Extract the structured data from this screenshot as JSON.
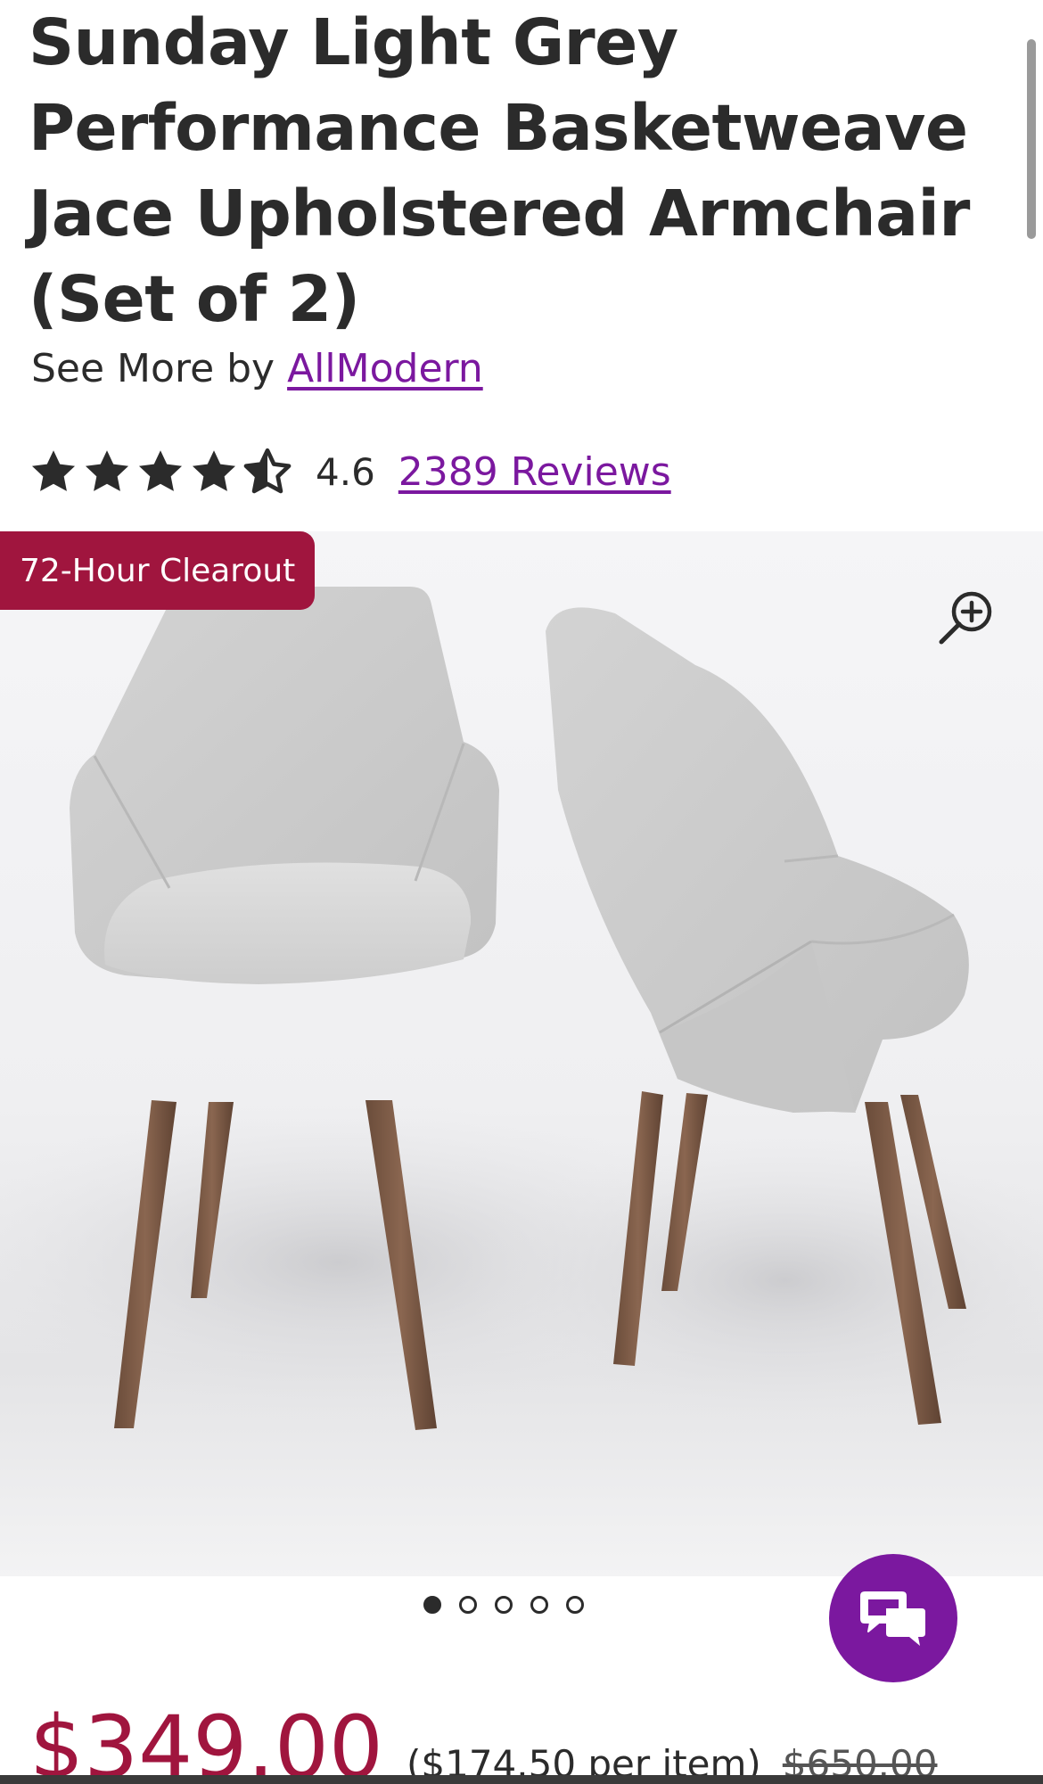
{
  "product": {
    "title": "Sunday Light Grey\nPerformance Basketweave\nJace Upholstered Armchair\n(Set of 2)",
    "see_more_prefix": "See More by ",
    "brand": "AllModern",
    "rating": 4.6,
    "rating_text": "4.6",
    "stars_max": 5,
    "reviews_label": "2389 Reviews"
  },
  "gallery": {
    "badge": "72-Hour Clearout",
    "zoom_icon": "zoom-in-icon",
    "slide_count": 5,
    "active_slide": 1
  },
  "pricing": {
    "price": "$349.00",
    "per_item": "($174.50 per item)",
    "original_price": "$650.00"
  },
  "chat": {
    "icon": "chat-bubbles-icon"
  },
  "colors": {
    "brand_purple": "#7b189f",
    "sale_red": "#a0153e",
    "text": "#2b2b2b"
  }
}
